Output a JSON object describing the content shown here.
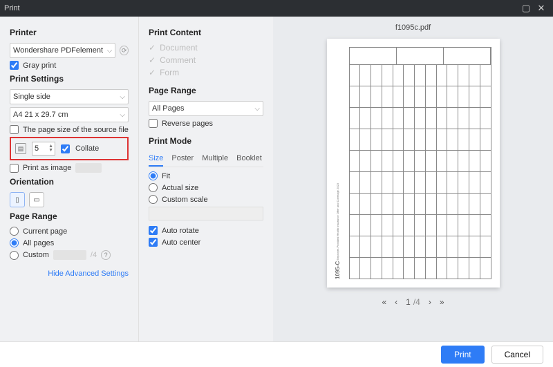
{
  "window": {
    "title": "Print"
  },
  "left": {
    "printer_heading": "Printer",
    "printer_selected": "Wondershare PDFelement",
    "gray_print": "Gray print",
    "settings_heading": "Print Settings",
    "side_selected": "Single side",
    "paper_selected": "A4 21 x 29.7 cm",
    "source_size": "The page size of the source file",
    "copies_value": "5",
    "collate": "Collate",
    "print_as_image": "Print as image",
    "orientation_heading": "Orientation",
    "page_range_heading": "Page Range",
    "current_page": "Current page",
    "all_pages": "All pages",
    "custom": "Custom",
    "hide_advanced": "Hide Advanced Settings"
  },
  "mid": {
    "content_heading": "Print Content",
    "doc": "Document",
    "comment": "Comment",
    "form": "Form",
    "page_range_heading": "Page Range",
    "all_pages": "All Pages",
    "reverse": "Reverse pages",
    "mode_heading": "Print Mode",
    "tabs": {
      "size": "Size",
      "poster": "Poster",
      "multiple": "Multiple",
      "booklet": "Booklet"
    },
    "fit": "Fit",
    "actual": "Actual size",
    "custom_scale": "Custom scale",
    "auto_rotate": "Auto rotate",
    "auto_center": "Auto center"
  },
  "preview": {
    "filename": "f1095c.pdf",
    "form_number": "1095-C",
    "form_title": "Employer-Provided Health Insurance Offer and Coverage",
    "year": "2023",
    "current_page": "1",
    "sep": "/",
    "total_pages": "4",
    "nav": {
      "first": "«",
      "prev": "‹",
      "next": "›",
      "last": "»"
    }
  },
  "footer": {
    "print": "Print",
    "cancel": "Cancel"
  }
}
